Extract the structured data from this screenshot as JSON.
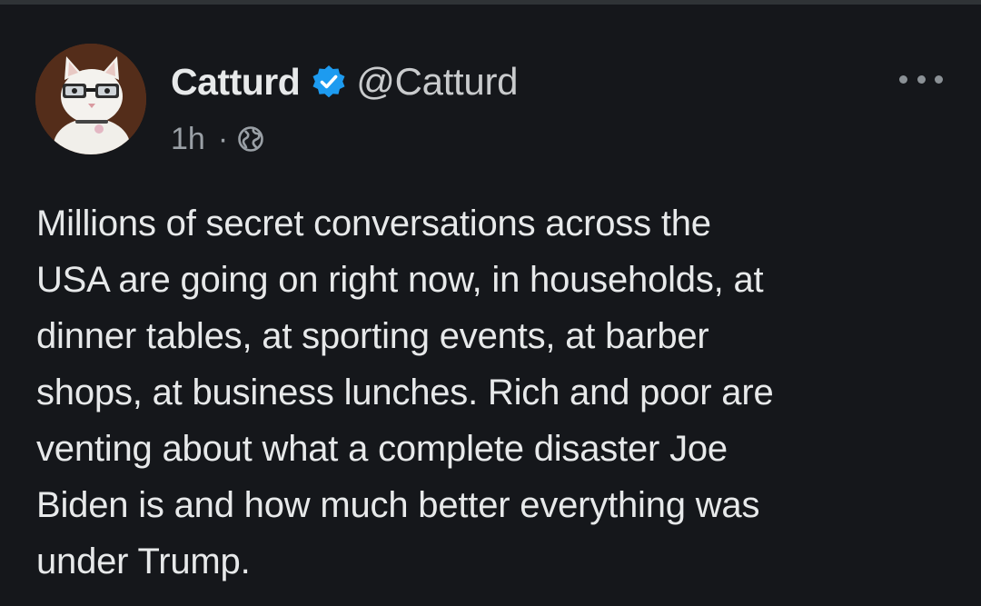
{
  "author": {
    "display_name": "Catturd",
    "handle": "@Catturd",
    "verified": true,
    "avatar_icon": "cat-with-glasses-avatar"
  },
  "meta": {
    "time": "1h",
    "separator": "·",
    "visibility_icon": "globe-icon"
  },
  "actions": {
    "more_icon": "more-options-icon"
  },
  "tweet": {
    "text": "Millions of secret conversations across the\nUSA are going on right now, in households, at\ndinner tables, at sporting events, at barber\nshops, at business lunches. Rich and poor are\nventing about what a complete disaster Joe\nBiden is and how much better everything was\nunder Trump."
  },
  "colors": {
    "background": "#15171b",
    "text": "#e7e9ea",
    "secondary": "#9aa0a6",
    "verified_badge": "#1d9bf0"
  }
}
